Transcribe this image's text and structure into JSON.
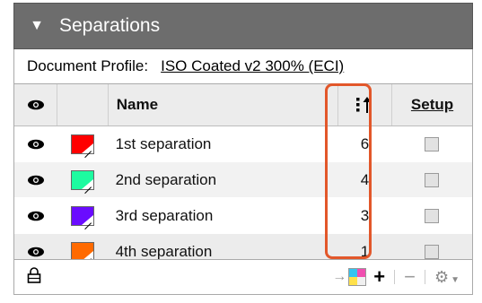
{
  "panel": {
    "title": "Separations",
    "collapse_glyph": "▼",
    "document_profile_label": "Document Profile:",
    "document_profile_value": "ISO Coated v2 300% (ECI)"
  },
  "table": {
    "header": {
      "name": "Name",
      "order_icon": "sort-order-icon",
      "setup": "Setup"
    },
    "rows": [
      {
        "name": "1st separation",
        "order": "6",
        "color": "#ff0000"
      },
      {
        "name": "2nd separation",
        "order": "4",
        "color": "#1dfba0"
      },
      {
        "name": "3rd separation",
        "order": "3",
        "color": "#6a0cff"
      },
      {
        "name": "4th separation",
        "order": "1",
        "color": "#ff6a00"
      }
    ]
  },
  "footer": {
    "add_label": "+",
    "remove_label": "−",
    "lock_icon": "lock-icon",
    "gear_icon": "gear-icon"
  },
  "highlight_color": "#e2572a"
}
